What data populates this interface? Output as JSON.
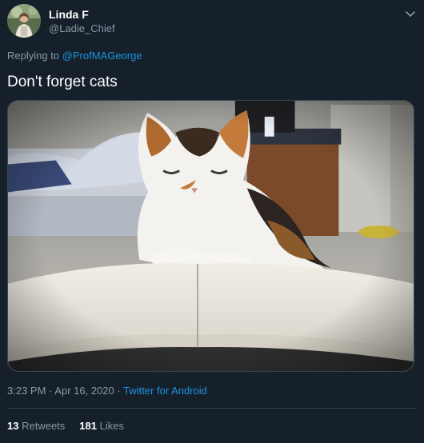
{
  "author": {
    "display_name": "Linda F",
    "handle": "@Ladie_Chief",
    "avatar_icon": "profile-photo"
  },
  "header": {
    "menu_icon": "chevron-down-icon"
  },
  "reply": {
    "prefix": "Replying to",
    "mention": "@ProfMAGeorge"
  },
  "tweet": {
    "text": "Don't forget cats",
    "media_icon": "photo-cat-on-book"
  },
  "meta": {
    "time": "3:23 PM",
    "sep1": "·",
    "date": "Apr 16, 2020",
    "sep2": "·",
    "source": "Twitter for Android"
  },
  "stats": {
    "retweets_count": "13",
    "retweets_label": "Retweets",
    "likes_count": "181",
    "likes_label": "Likes"
  },
  "colors": {
    "background": "#15202b",
    "text_primary": "#ffffff",
    "text_secondary": "#8899a6",
    "link": "#1b95e0",
    "divider": "#38444d"
  }
}
